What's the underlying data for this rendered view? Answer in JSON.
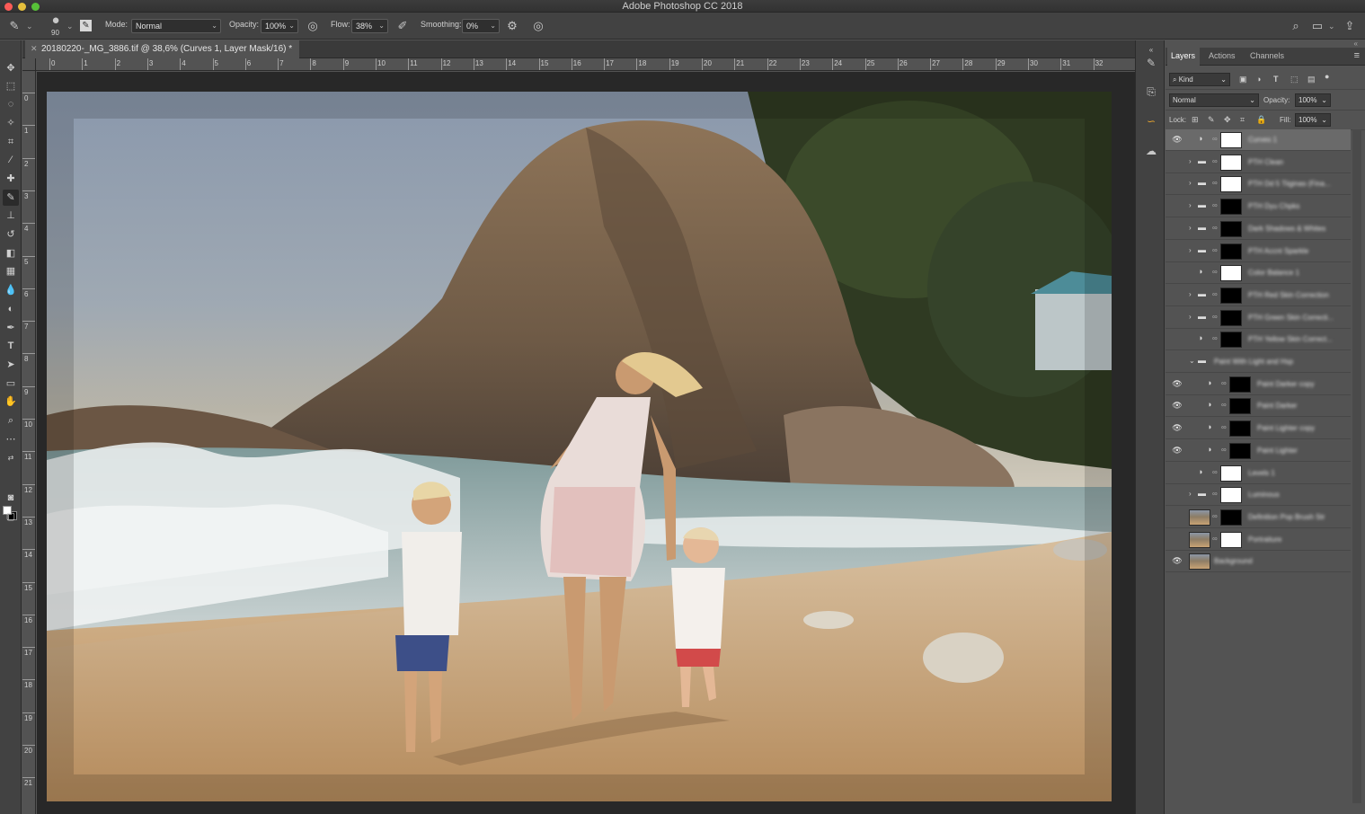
{
  "window": {
    "title": "Adobe Photoshop CC 2018"
  },
  "options_bar": {
    "brush_size": "90",
    "mode_label": "Mode:",
    "mode_value": "Normal",
    "opacity_label": "Opacity:",
    "opacity_value": "100%",
    "flow_label": "Flow:",
    "flow_value": "38%",
    "smoothing_label": "Smoothing:",
    "smoothing_value": "0%"
  },
  "document": {
    "tab_title": "20180220-_MG_3886.tif @ 38,6% (Curves 1, Layer Mask/16) *",
    "ruler_h": [
      "0",
      "1",
      "2",
      "3",
      "4",
      "5",
      "6",
      "7",
      "8",
      "9",
      "10",
      "11",
      "12",
      "13",
      "14",
      "15",
      "16",
      "17",
      "18",
      "19",
      "20",
      "21",
      "22",
      "23",
      "24",
      "25",
      "26",
      "27",
      "28",
      "29",
      "30",
      "31",
      "32"
    ],
    "ruler_v": [
      "0",
      "1",
      "2",
      "3",
      "4",
      "5",
      "6",
      "7",
      "8",
      "9",
      "10",
      "11",
      "12",
      "13",
      "14",
      "15",
      "16",
      "17",
      "18",
      "19",
      "20",
      "21"
    ]
  },
  "layers_panel": {
    "tabs": [
      "Layers",
      "Actions",
      "Channels"
    ],
    "kind_label": "Kind",
    "blend_mode": "Normal",
    "opacity_label": "Opacity:",
    "opacity_value": "100%",
    "lock_label": "Lock:",
    "fill_label": "Fill:",
    "fill_value": "100%",
    "layers": [
      {
        "name": "Curves 1",
        "visible": true,
        "type": "adjustment",
        "thumb": "white",
        "selected": true,
        "indent": 0
      },
      {
        "name": "PTH Clean",
        "visible": false,
        "type": "group",
        "thumb": "white",
        "indent": 0
      },
      {
        "name": "PTH Dd 5 Tiiginas (Fina...",
        "visible": false,
        "type": "group",
        "thumb": "white",
        "indent": 0
      },
      {
        "name": "PTH Dyu Chpks",
        "visible": false,
        "type": "group",
        "thumb": "black",
        "indent": 0
      },
      {
        "name": "Dark Shadows & Whites",
        "visible": false,
        "type": "group",
        "thumb": "black",
        "indent": 0
      },
      {
        "name": "PTH Accnt Sparkle",
        "visible": false,
        "type": "group",
        "thumb": "black",
        "indent": 0
      },
      {
        "name": "Color Balance 1",
        "visible": false,
        "type": "adjustment",
        "thumb": "white",
        "indent": 0
      },
      {
        "name": "PTH Red Skin Correction",
        "visible": false,
        "type": "group",
        "thumb": "black",
        "indent": 0
      },
      {
        "name": "PTH Green Skin Correcti...",
        "visible": false,
        "type": "group",
        "thumb": "black",
        "indent": 0
      },
      {
        "name": "PTH Yellow Skin Correct...",
        "visible": false,
        "type": "adjustment",
        "thumb": "black",
        "indent": 0
      },
      {
        "name": "Paint With Light and Hsp",
        "visible": false,
        "type": "group-open",
        "thumb": "",
        "indent": 0
      },
      {
        "name": "Paint Darker copy",
        "visible": true,
        "type": "adjustment",
        "thumb": "black",
        "indent": 1
      },
      {
        "name": "Paint Darker",
        "visible": true,
        "type": "adjustment",
        "thumb": "black",
        "indent": 1
      },
      {
        "name": "Paint Lighter copy",
        "visible": true,
        "type": "adjustment",
        "thumb": "black",
        "indent": 1
      },
      {
        "name": "Paint Lighter",
        "visible": true,
        "type": "adjustment",
        "thumb": "black",
        "indent": 1
      },
      {
        "name": "Levels 1",
        "visible": false,
        "type": "adjustment",
        "thumb": "white",
        "indent": 0
      },
      {
        "name": "Luminous",
        "visible": false,
        "type": "group",
        "thumb": "white",
        "indent": 0
      },
      {
        "name": "Definition Pop Brush Str",
        "visible": false,
        "type": "pixel-mask",
        "thumb": "black",
        "indent": 0
      },
      {
        "name": "Portraiture",
        "visible": false,
        "type": "pixel-mask",
        "thumb": "white",
        "indent": 0
      },
      {
        "name": "Background",
        "visible": true,
        "type": "pixel",
        "thumb": "",
        "indent": 0
      }
    ]
  },
  "icons": {
    "eye": "eye-icon",
    "folder": "folder-icon",
    "adjustment": "half-circle-icon"
  }
}
